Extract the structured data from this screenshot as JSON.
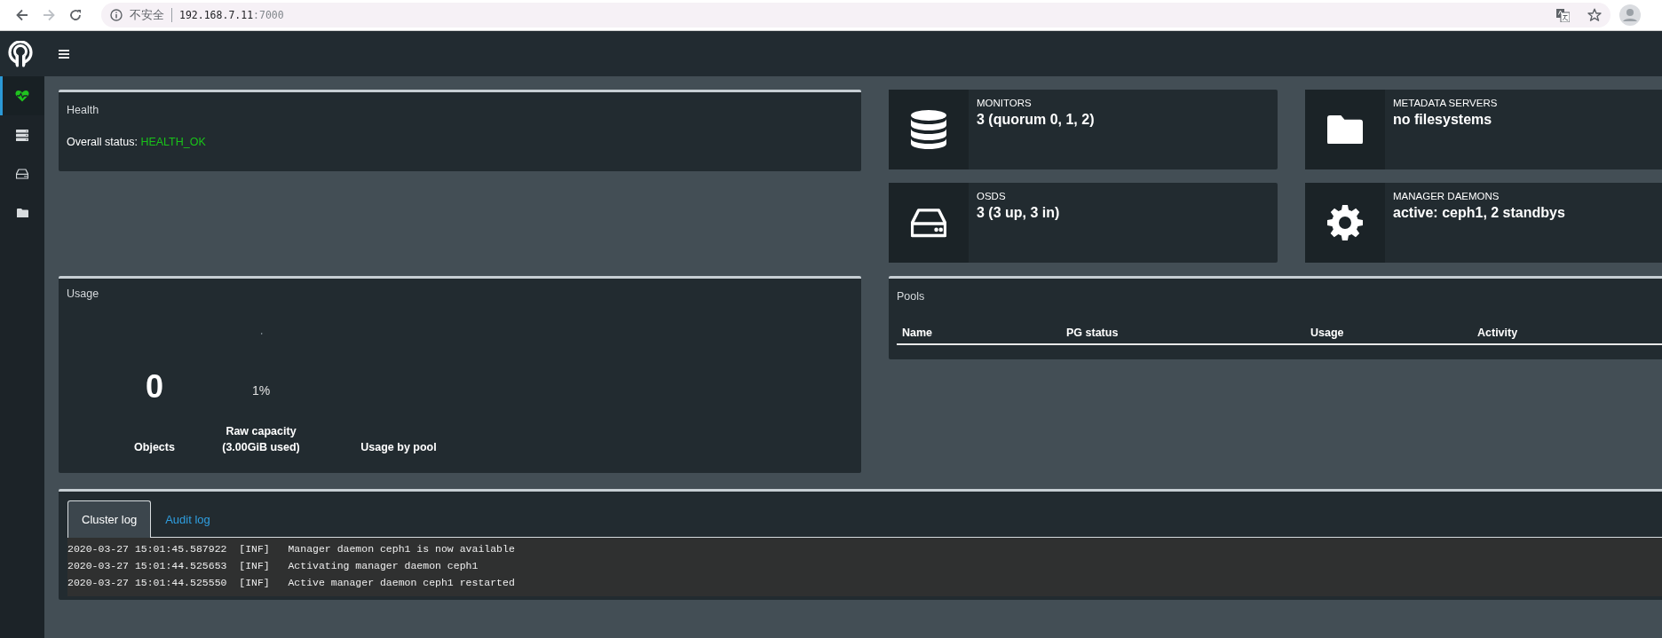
{
  "browser": {
    "security_label": "不安全",
    "url_host": "192.168.7.11",
    "url_port": ":7000"
  },
  "sidebar": {
    "items": [
      {
        "kind": "heartbeat",
        "selected": true
      },
      {
        "kind": "servers",
        "selected": false
      },
      {
        "kind": "drive",
        "selected": false
      },
      {
        "kind": "folder",
        "selected": false
      }
    ]
  },
  "health": {
    "title": "Health",
    "status_label": "Overall status:",
    "status_value": "HEALTH_OK"
  },
  "usage": {
    "title": "Usage",
    "objects_value": "0",
    "objects_label": "Objects",
    "raw_capacity": {
      "level": 0.01,
      "reading": "1%",
      "label": "Raw capacity",
      "sublabel": "(3.00GiB used)"
    },
    "by_pool_label": "Usage by pool"
  },
  "info_cards": [
    {
      "kind": "database",
      "title": "MONITORS",
      "value": "3 (quorum 0, 1, 2)"
    },
    {
      "kind": "folder",
      "title": "METADATA SERVERS",
      "value": "no filesystems"
    },
    {
      "kind": "drive",
      "title": "OSDS",
      "value": "3 (3 up, 3 in)"
    },
    {
      "kind": "gear",
      "title": "MANAGER DAEMONS",
      "value": "active: ceph1, 2 standbys"
    }
  ],
  "pools": {
    "title": "Pools",
    "columns": [
      "Name",
      "PG status",
      "Usage",
      "Activity"
    ]
  },
  "log": {
    "tabs": [
      {
        "label": "Cluster log",
        "selected": true
      },
      {
        "label": "Audit log",
        "selected": false
      }
    ],
    "rows": [
      {
        "time": "2020-03-27 15:01:45.587922",
        "severity": "[INF]",
        "message": "Manager daemon ceph1 is now available"
      },
      {
        "time": "2020-03-27 15:01:44.525653",
        "severity": "[INF]",
        "message": "Activating manager daemon ceph1"
      },
      {
        "time": "2020-03-27 15:01:44.525550",
        "severity": "[INF]",
        "message": "Active manager daemon ceph1 restarted"
      }
    ]
  }
}
